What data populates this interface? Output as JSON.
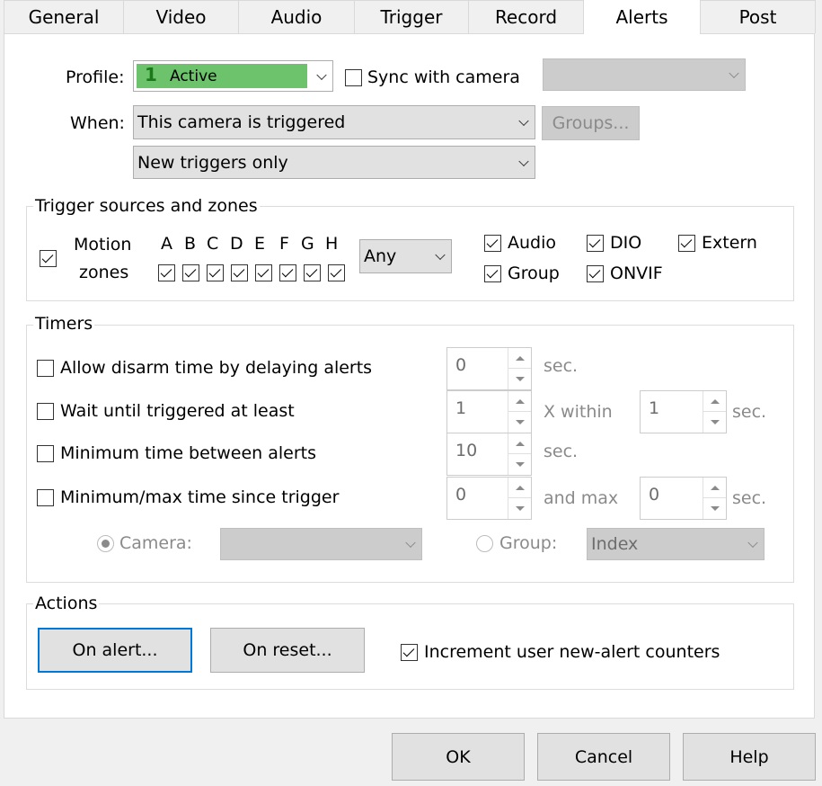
{
  "tabs": [
    "General",
    "Video",
    "Audio",
    "Trigger",
    "Record",
    "Alerts",
    "Post"
  ],
  "active_tab": "Alerts",
  "profile": {
    "label": "Profile:",
    "number": "1",
    "value": "Active",
    "color": "#6cc36c",
    "sync_label": "Sync with camera",
    "sync_checked": false
  },
  "when": {
    "label": "When:",
    "value": "This camera is triggered",
    "groups_button": "Groups...",
    "triggers_value": "New triggers only"
  },
  "trigger_sources": {
    "title": "Trigger sources and zones",
    "motion_checked": true,
    "motion_label_1": "Motion",
    "motion_label_2": "zones",
    "zones": [
      "A",
      "B",
      "C",
      "D",
      "E",
      "F",
      "G",
      "H"
    ],
    "zone_mode": "Any",
    "audio": "Audio",
    "dio": "DIO",
    "extern": "Extern",
    "group": "Group",
    "onvif": "ONVIF"
  },
  "timers": {
    "title": "Timers",
    "disarm_label": "Allow disarm time by delaying alerts",
    "disarm_value": "0",
    "sec": "sec.",
    "wait_label": "Wait until triggered at least",
    "wait_value": "1",
    "x_within": "X within",
    "within_value": "1",
    "min_between_label": "Minimum time between alerts",
    "min_between_value": "10",
    "minmax_label": "Minimum/max time since trigger",
    "min_value": "0",
    "and_max": "and max",
    "max_value": "0",
    "camera_label": "Camera:",
    "group_label": "Group:",
    "group_value": "Index"
  },
  "actions": {
    "title": "Actions",
    "on_alert": "On alert...",
    "on_reset": "On reset...",
    "increment_label": "Increment user new-alert counters",
    "increment_checked": true
  },
  "footer": {
    "ok": "OK",
    "cancel": "Cancel",
    "help": "Help"
  }
}
